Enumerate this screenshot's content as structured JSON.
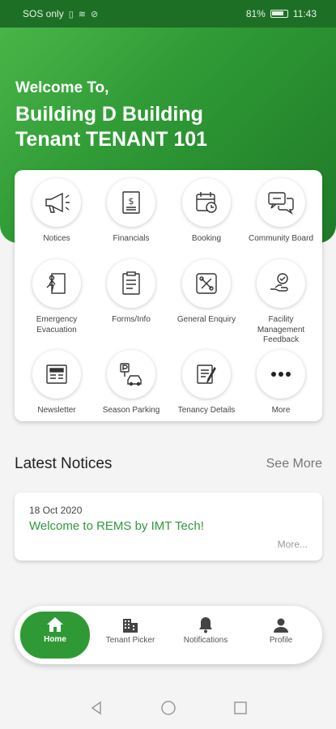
{
  "status_bar": {
    "left_text": "SOS only",
    "battery": "81%",
    "time": "11:43"
  },
  "header": {
    "welcome": "Welcome To,",
    "building_line1": "Building D Building",
    "building_line2": "Tenant TENANT 101"
  },
  "menu": [
    {
      "label": "Notices",
      "icon": "megaphone-icon"
    },
    {
      "label": "Financials",
      "icon": "invoice-icon"
    },
    {
      "label": "Booking",
      "icon": "calendar-clock-icon"
    },
    {
      "label": "Community Board",
      "icon": "chat-bubbles-icon"
    },
    {
      "label": "Emergency Evacuation",
      "icon": "evacuation-icon"
    },
    {
      "label": "Forms/Info",
      "icon": "forms-icon"
    },
    {
      "label": "General Enquiry",
      "icon": "tools-icon"
    },
    {
      "label": "Facility Management Feedback",
      "icon": "feedback-hand-icon"
    },
    {
      "label": "Newsletter",
      "icon": "newspaper-icon"
    },
    {
      "label": "Season Parking",
      "icon": "parking-car-icon"
    },
    {
      "label": "Tenancy Details",
      "icon": "contract-icon"
    },
    {
      "label": "More",
      "icon": "more-dots-icon"
    }
  ],
  "notices": {
    "title": "Latest Notices",
    "see_more": "See More",
    "items": [
      {
        "date": "18 Oct 2020",
        "title": "Welcome to REMS by IMT Tech!",
        "more": "More..."
      }
    ]
  },
  "bottom_nav": [
    {
      "label": "Home",
      "icon": "home-icon",
      "active": true
    },
    {
      "label": "Tenant Picker",
      "icon": "building-icon",
      "active": false
    },
    {
      "label": "Notifications",
      "icon": "bell-icon",
      "active": false
    },
    {
      "label": "Profile",
      "icon": "person-icon",
      "active": false
    }
  ],
  "colors": {
    "brand_green": "#2f9a35",
    "notice_title": "#2e9a3a"
  }
}
